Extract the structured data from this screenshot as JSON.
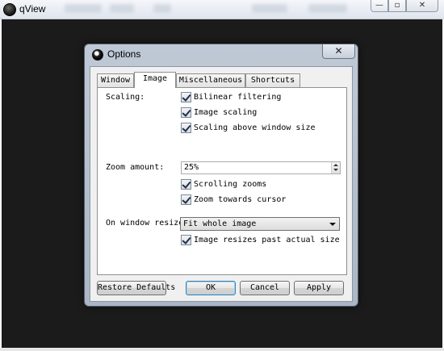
{
  "window": {
    "title": "qView",
    "controls": {
      "minimize": "—",
      "maximize": "▫",
      "close": "✕"
    }
  },
  "dialog": {
    "title": "Options",
    "close_glyph": "✕",
    "tabs": [
      {
        "label": "Window",
        "active": false
      },
      {
        "label": "Image",
        "active": true
      },
      {
        "label": "Miscellaneous",
        "active": false
      },
      {
        "label": "Shortcuts",
        "active": false
      }
    ],
    "image_tab": {
      "scaling_label": "Scaling:",
      "scaling_options": [
        {
          "label": "Bilinear filtering",
          "checked": true
        },
        {
          "label": "Image scaling",
          "checked": true
        },
        {
          "label": "Scaling above window size",
          "checked": true
        }
      ],
      "zoom_label": "Zoom amount:",
      "zoom_value": "25%",
      "zoom_options": [
        {
          "label": "Scrolling zooms",
          "checked": true
        },
        {
          "label": "Zoom towards cursor",
          "checked": true
        }
      ],
      "resize_label": "On window resize:",
      "resize_selected": "Fit whole image",
      "resize_options": [
        {
          "label": "Image resizes past actual size",
          "checked": true
        }
      ]
    },
    "buttons": {
      "restore": "Restore Defaults",
      "ok": "OK",
      "cancel": "Cancel",
      "apply": "Apply"
    }
  },
  "colors": {
    "canvas": "#1b1b1b",
    "dialog_frame": "#aab6c5",
    "panel": "#ffffff",
    "default_button_border": "#3c7fb1"
  }
}
